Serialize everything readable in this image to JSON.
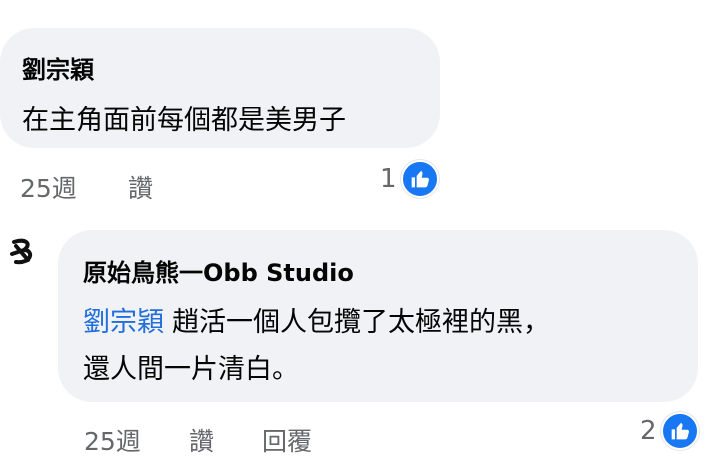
{
  "comments": [
    {
      "author": "劉宗穎",
      "text": "在主角面前每個都是美男子",
      "time": "25週",
      "like_label": "讚",
      "reaction_count": "1",
      "reaction_icon": "thumbs-up-icon"
    },
    {
      "author": "原始鳥熊一Obb Studio",
      "mention": "劉宗穎",
      "text_line1": "趙活一個人包攬了太極裡的黑，",
      "text_line2": "還人間一片清白。",
      "time": "25週",
      "like_label": "讚",
      "reply_label": "回覆",
      "reaction_count": "2",
      "reaction_icon": "thumbs-up-icon",
      "avatar_icon": "obb-studio-logo-icon"
    }
  ],
  "colors": {
    "bubble": "#f0f2f5",
    "mention": "#216fdb",
    "meta_text": "#65676b",
    "like_badge": "#1877f2"
  }
}
